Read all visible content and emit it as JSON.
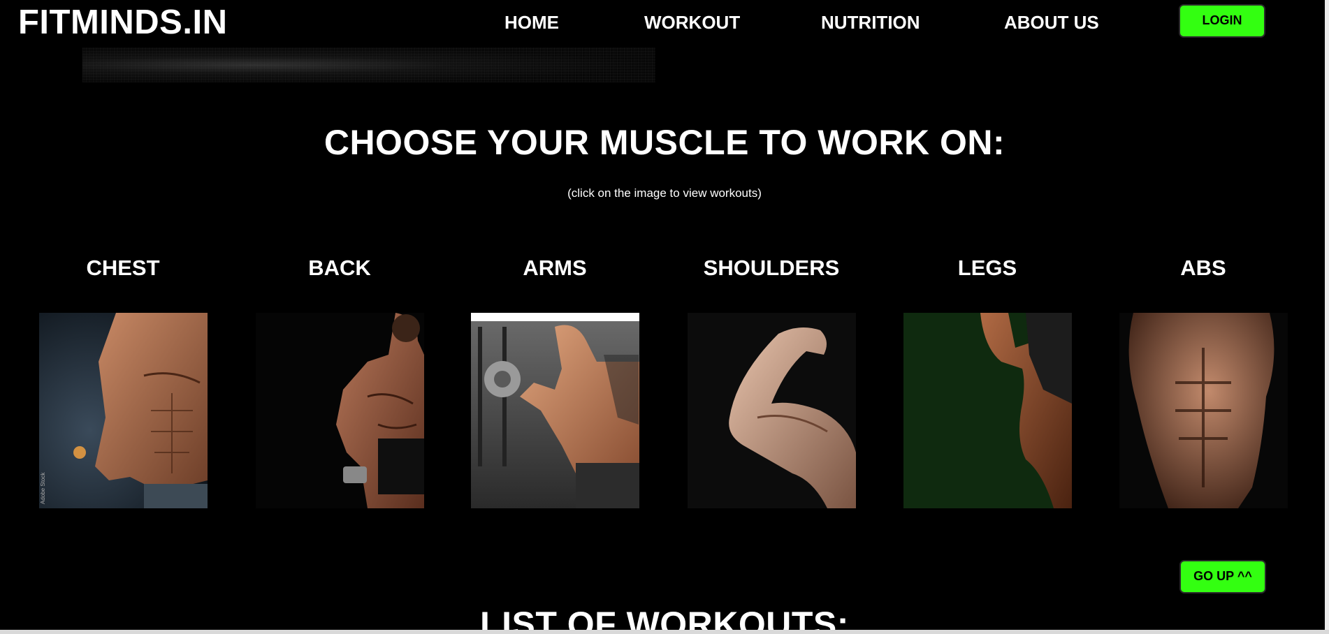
{
  "header": {
    "brand": "FITMINDS.IN",
    "nav": {
      "home": "HOME",
      "workout": "WORKOUT",
      "nutrition": "NUTRITION",
      "about": "ABOUT US"
    },
    "login_label": "LOGIN"
  },
  "main": {
    "heading": "CHOOSE YOUR MUSCLE TO WORK ON:",
    "hint": "(click on the image to view workouts)",
    "muscles": [
      {
        "label": "CHEST",
        "icon": "chest-photo"
      },
      {
        "label": "BACK",
        "icon": "back-photo"
      },
      {
        "label": "ARMS",
        "icon": "arms-photo"
      },
      {
        "label": "SHOULDERS",
        "icon": "shoulders-photo"
      },
      {
        "label": "LEGS",
        "icon": "legs-photo"
      },
      {
        "label": "ABS",
        "icon": "abs-photo"
      }
    ],
    "go_up_label": "GO UP ^^",
    "list_heading": "LIST OF WORKOUTS:"
  },
  "colors": {
    "background": "#000000",
    "accent_green": "#33ff11",
    "text": "#ffffff"
  }
}
